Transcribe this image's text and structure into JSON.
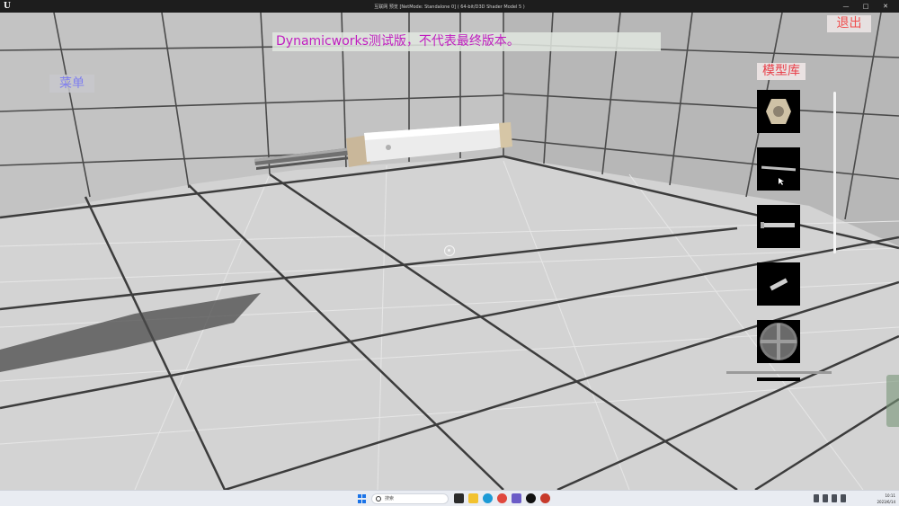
{
  "window": {
    "title": "互联网 预览 [NetMode: Standalone 0]  ( 64-bit/D3D Shader Model 5 )",
    "controls": [
      "—",
      "□",
      "✕"
    ]
  },
  "overlay": {
    "banner_text": "Dynamicworks测试版，不代表最终版本。",
    "menu_label": "菜单",
    "exit_label": "退出",
    "model_library_label": "模型库"
  },
  "model_library": {
    "items": [
      {
        "name": "hex-nut-model-thumbnail"
      },
      {
        "name": "long-rod-model-thumbnail"
      },
      {
        "name": "shaft-model-thumbnail"
      },
      {
        "name": "short-pin-model-thumbnail"
      },
      {
        "name": "round-cap-model-thumbnail"
      }
    ]
  },
  "taskbar": {
    "search_placeholder": "搜索",
    "clock_time": "10:11",
    "clock_date": "2023/6/14",
    "icons": [
      "windows-start-icon",
      "search-icon",
      "file-explorer-icon",
      "folder-icon",
      "edge-browser-icon",
      "chrome-icon",
      "app-icon",
      "unreal-engine-icon",
      "app-red-icon"
    ]
  },
  "colors": {
    "banner_text": "#c01ec0",
    "menu_text": "#8080ee",
    "exit_text": "#ef5050",
    "library_title_text": "#e8404a"
  }
}
